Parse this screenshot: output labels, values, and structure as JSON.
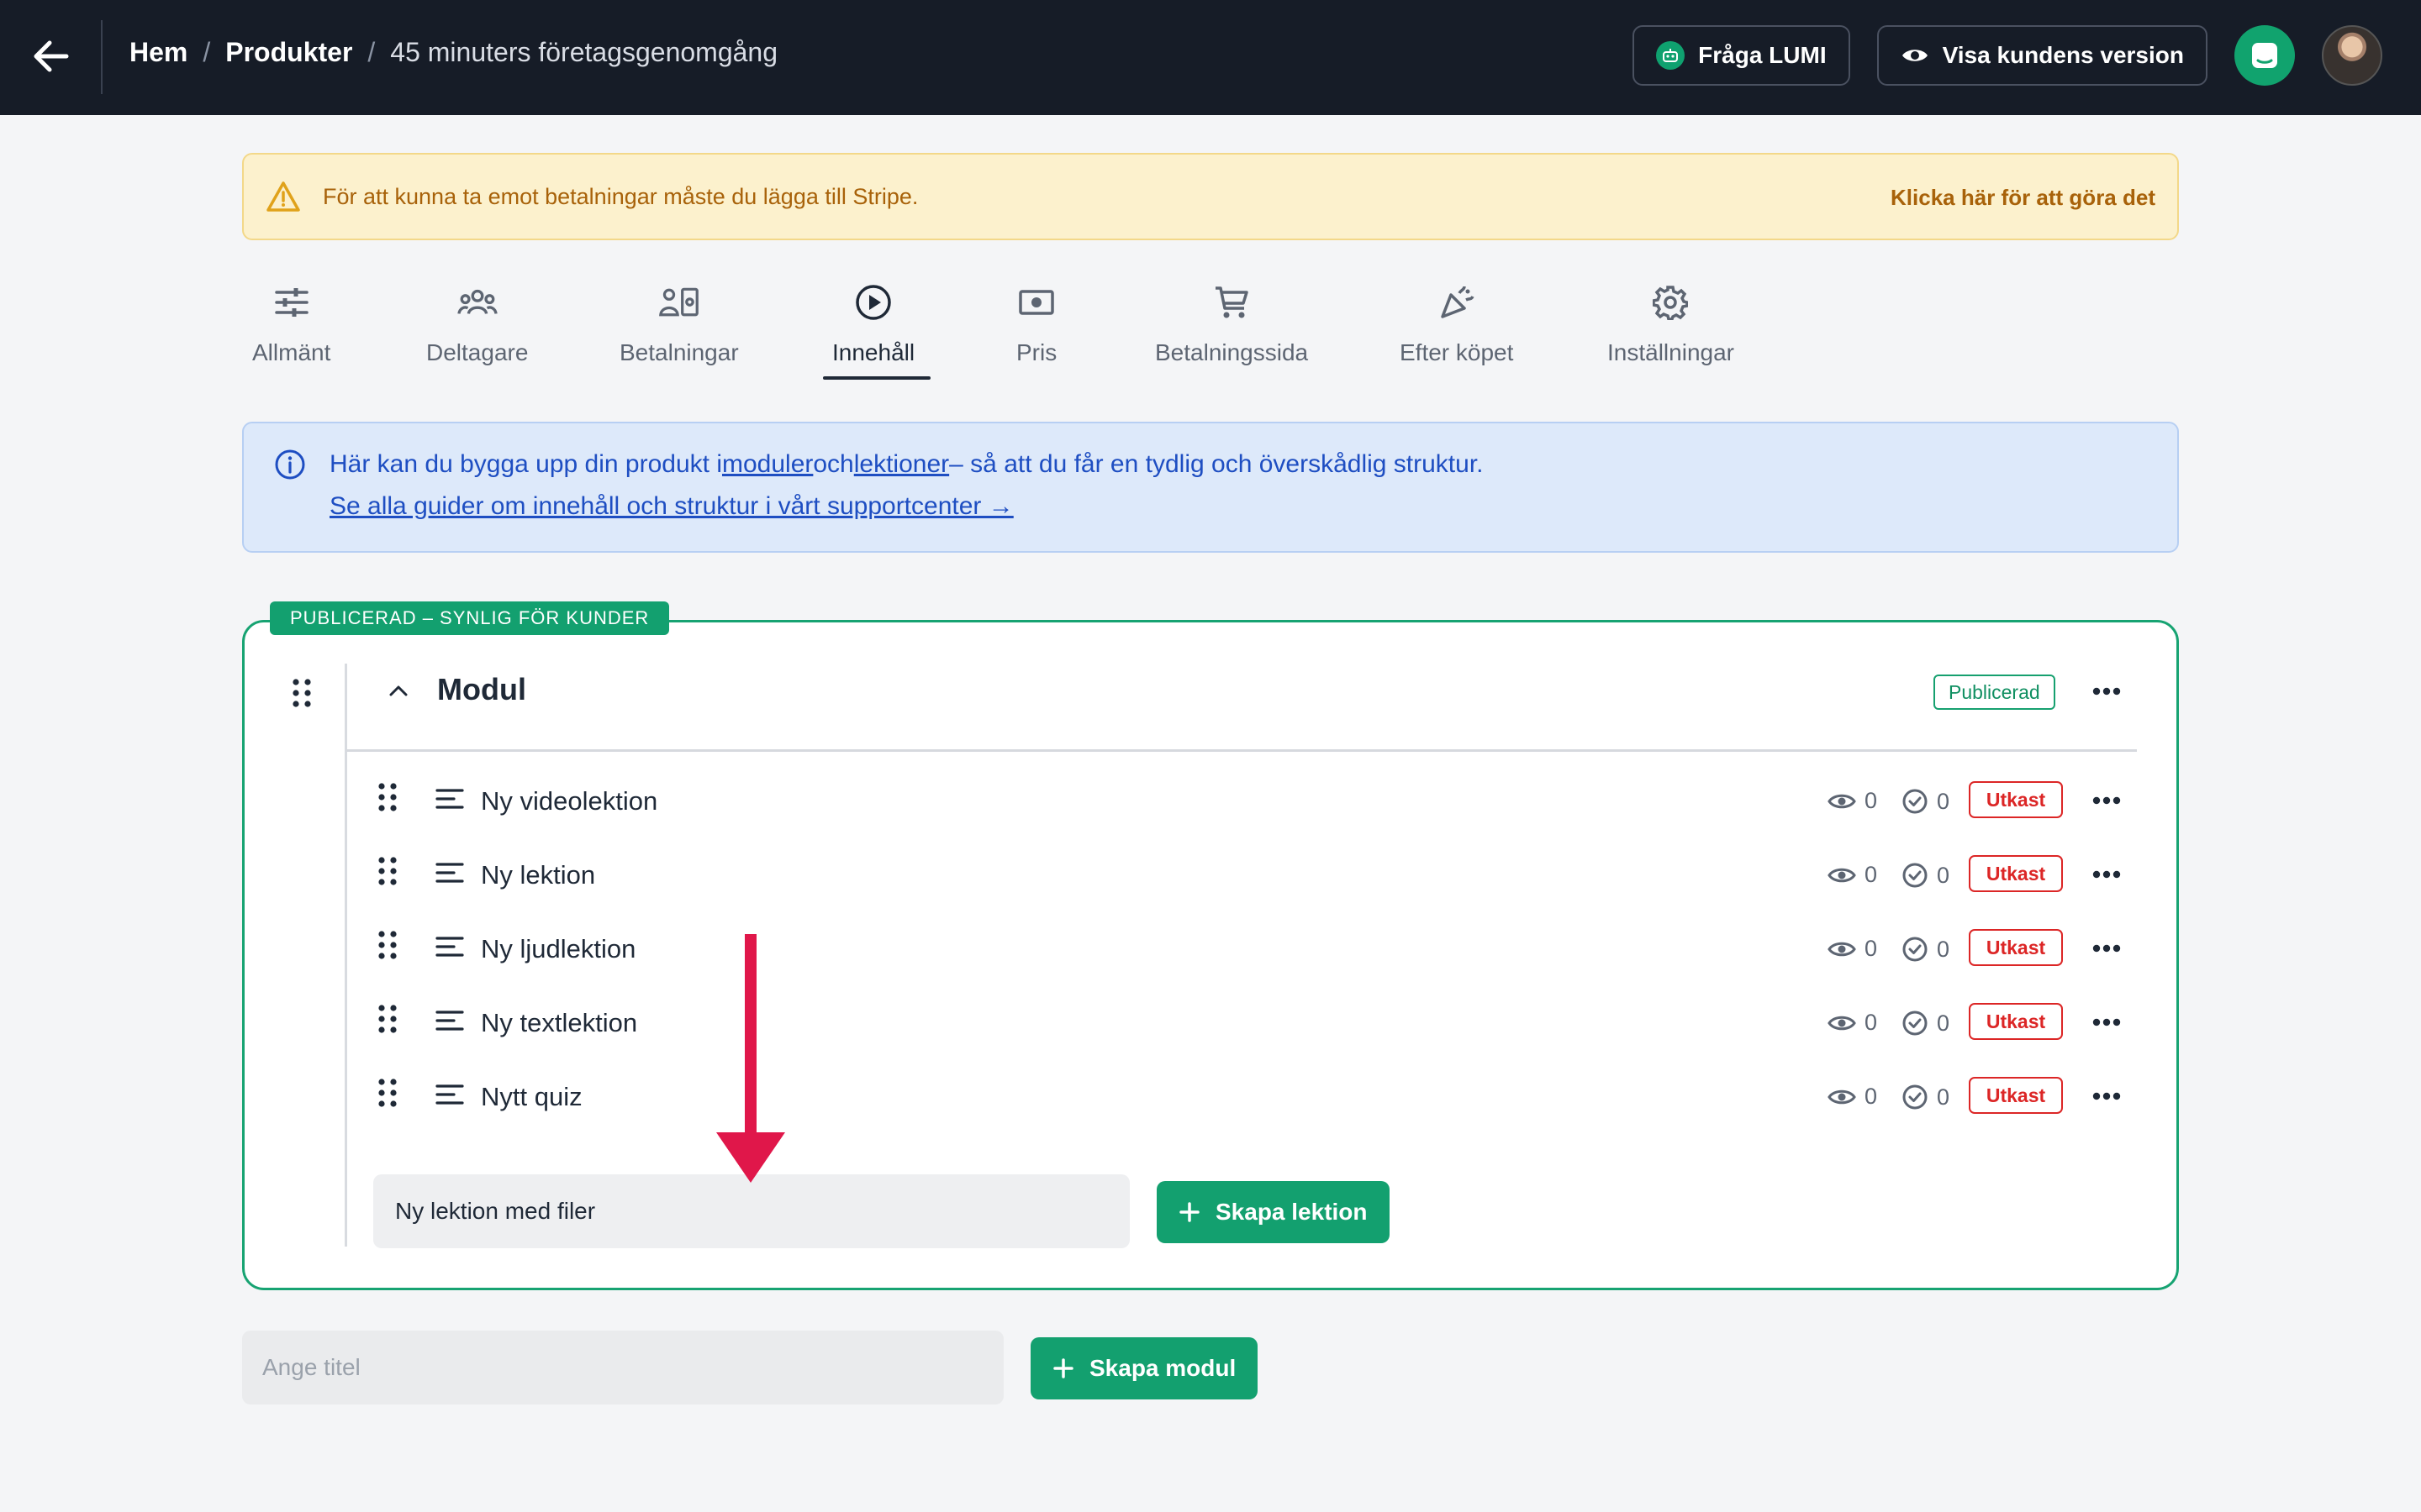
{
  "header": {
    "breadcrumb": {
      "home": "Hem",
      "separator": "/",
      "products": "Produkter",
      "current": "45 minuters företagsgenomgång"
    },
    "ask_lumi_label": "Fråga LUMI",
    "customer_view_label": "Visa kundens version"
  },
  "warning": {
    "text": "För att kunna ta emot betalningar måste du lägga till Stripe.",
    "link": "Klicka här för att göra det"
  },
  "tabs": [
    {
      "label": "Allmänt",
      "icon": "sliders-icon"
    },
    {
      "label": "Deltagare",
      "icon": "users-icon"
    },
    {
      "label": "Betalningar",
      "icon": "payments-icon"
    },
    {
      "label": "Innehåll",
      "icon": "play-circle-icon",
      "active": true
    },
    {
      "label": "Pris",
      "icon": "banknote-icon"
    },
    {
      "label": "Betalningssida",
      "icon": "cart-icon"
    },
    {
      "label": "Efter köpet",
      "icon": "party-icon"
    },
    {
      "label": "Inställningar",
      "icon": "gear-icon"
    }
  ],
  "info": {
    "line1_prefix": "Här kan du bygga upp din produkt i",
    "line1_link1": "moduler",
    "line1_mid": "och",
    "line1_link2": "lektioner",
    "line1_suffix": "– så att du får en tydlig och överskådlig struktur.",
    "line2": "Se alla guider om innehåll och struktur i vårt supportcenter →"
  },
  "module": {
    "tag": "PUBLICERAD – SYNLIG FÖR KUNDER",
    "title": "Modul",
    "status": "Publicerad",
    "lessons": [
      {
        "title": "Ny videolektion",
        "views": "0",
        "completions": "0",
        "status": "Utkast"
      },
      {
        "title": "Ny lektion",
        "views": "0",
        "completions": "0",
        "status": "Utkast"
      },
      {
        "title": "Ny ljudlektion",
        "views": "0",
        "completions": "0",
        "status": "Utkast"
      },
      {
        "title": "Ny textlektion",
        "views": "0",
        "completions": "0",
        "status": "Utkast"
      },
      {
        "title": "Nytt quiz",
        "views": "0",
        "completions": "0",
        "status": "Utkast"
      }
    ],
    "new_lesson_value": "Ny lektion med filer",
    "create_lesson_label": "Skapa lektion"
  },
  "new_module": {
    "placeholder": "Ange titel",
    "create_label": "Skapa modul"
  },
  "colors": {
    "topbar": "#161c27",
    "accent_green": "#13a06f",
    "draft_red": "#dc2626",
    "annotation_arrow": "#e0174a"
  }
}
